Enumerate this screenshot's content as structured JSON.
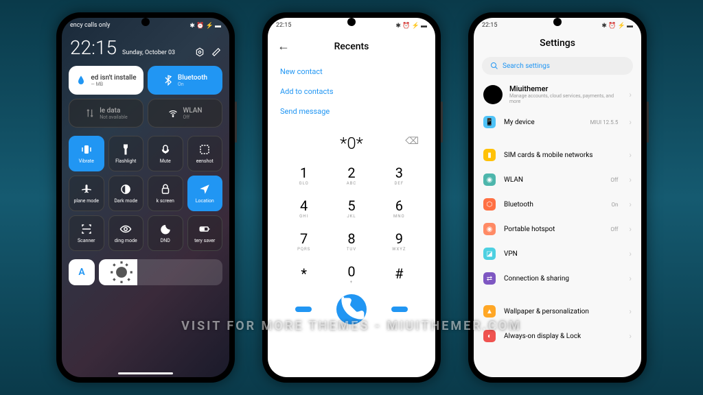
{
  "status_time": "22:15",
  "status_icons": "✱ ⏰ ⚡ ▬",
  "p1": {
    "status_left": "ency calls only",
    "time": "22:15",
    "date": "Sunday, October 03",
    "big_tiles": [
      {
        "title": "ed isn't installe",
        "sub": "— MB"
      },
      {
        "title": "Bluetooth",
        "sub": "On"
      },
      {
        "title": "le data",
        "sub": "Not available"
      },
      {
        "title": "WLAN",
        "sub": "Off"
      }
    ],
    "small_tiles": [
      {
        "label": "Vibrate",
        "icon": "vibrate"
      },
      {
        "label": "Flashlight",
        "icon": "flashlight"
      },
      {
        "label": "Mute",
        "icon": "mute"
      },
      {
        "label": "eenshot",
        "icon": "screenshot"
      },
      {
        "label": "plane mode",
        "icon": "airplane"
      },
      {
        "label": "Dark mode",
        "icon": "dark"
      },
      {
        "label": "k screen",
        "icon": "lock"
      },
      {
        "label": "Location",
        "icon": "location"
      },
      {
        "label": "Scanner",
        "icon": "scanner"
      },
      {
        "label": "ding mode",
        "icon": "reading"
      },
      {
        "label": "DND",
        "icon": "dnd"
      },
      {
        "label": "tery saver",
        "icon": "battery"
      }
    ],
    "auto_label": "A"
  },
  "p2": {
    "title": "Recents",
    "options": [
      "New contact",
      "Add to contacts",
      "Send message"
    ],
    "display": "*0*",
    "keys": [
      {
        "n": "1",
        "l": "GLO"
      },
      {
        "n": "2",
        "l": "ABC"
      },
      {
        "n": "3",
        "l": "DEF"
      },
      {
        "n": "4",
        "l": "GHI"
      },
      {
        "n": "5",
        "l": "JKL"
      },
      {
        "n": "6",
        "l": "MNO"
      },
      {
        "n": "7",
        "l": "PQRS"
      },
      {
        "n": "8",
        "l": "TUV"
      },
      {
        "n": "9",
        "l": "WXYZ"
      },
      {
        "n": "*",
        "l": ""
      },
      {
        "n": "0",
        "l": "+"
      },
      {
        "n": "#",
        "l": ""
      }
    ]
  },
  "p3": {
    "title": "Settings",
    "search": "Search settings",
    "account_name": "Miuithemer",
    "account_sub": "Manage accounts, cloud services, payments, and more",
    "items": [
      {
        "label": "My device",
        "val": "MIUI 12.5.5",
        "color": "ic-phone",
        "g": "📱"
      },
      {
        "label": "SIM cards & mobile networks",
        "val": "",
        "color": "ic-sim",
        "g": "▮"
      },
      {
        "label": "WLAN",
        "val": "Off",
        "color": "ic-wlan",
        "g": "◉"
      },
      {
        "label": "Bluetooth",
        "val": "On",
        "color": "ic-bt",
        "g": "⬡"
      },
      {
        "label": "Portable hotspot",
        "val": "Off",
        "color": "ic-hotspot",
        "g": "◉"
      },
      {
        "label": "VPN",
        "val": "",
        "color": "ic-vpn",
        "g": "◪"
      },
      {
        "label": "Connection & sharing",
        "val": "",
        "color": "ic-conn",
        "g": "⇄"
      },
      {
        "label": "Wallpaper & personalization",
        "val": "",
        "color": "ic-wall",
        "g": "▲"
      },
      {
        "label": "Always-on display & Lock",
        "val": "",
        "color": "ic-aod",
        "g": "◐"
      }
    ]
  },
  "watermark": "VISIT FOR MORE THEMES - MIUITHEMER.COM"
}
